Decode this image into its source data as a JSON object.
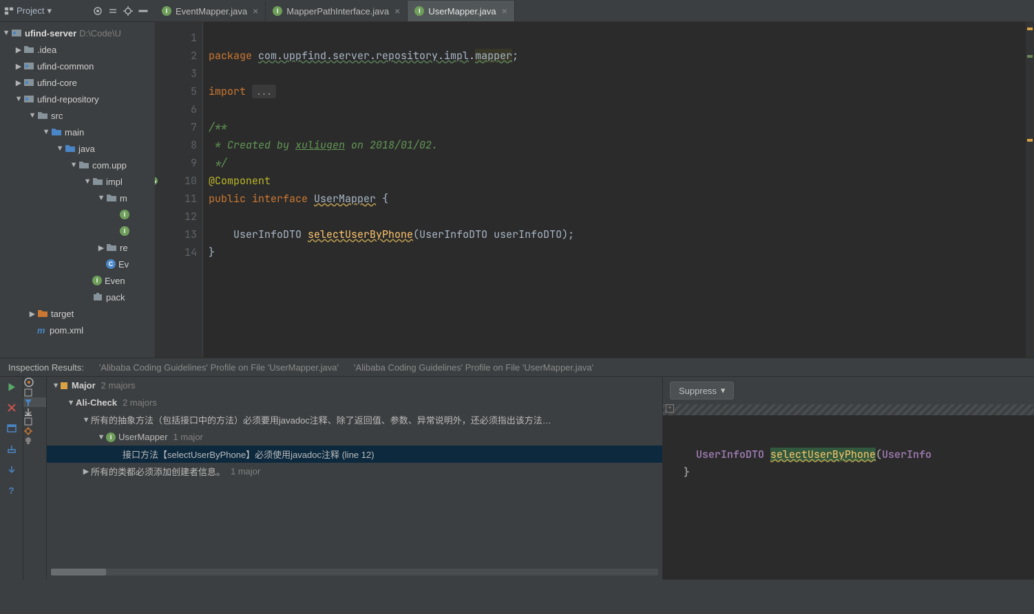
{
  "projectPanel": {
    "title": "Project",
    "root": {
      "label": "ufind-server",
      "path": "D:\\Code\\U"
    },
    "nodes": [
      {
        "indent": 22,
        "arrow": "▶",
        "icon": "folder",
        "label": ".idea"
      },
      {
        "indent": 22,
        "arrow": "▶",
        "icon": "module",
        "label": "ufind-common"
      },
      {
        "indent": 22,
        "arrow": "▶",
        "icon": "module",
        "label": "ufind-core"
      },
      {
        "indent": 22,
        "arrow": "▼",
        "icon": "module",
        "label": "ufind-repository"
      },
      {
        "indent": 42,
        "arrow": "▼",
        "icon": "folder",
        "label": "src"
      },
      {
        "indent": 62,
        "arrow": "▼",
        "icon": "folder-blue",
        "label": "main"
      },
      {
        "indent": 82,
        "arrow": "▼",
        "icon": "folder-blue",
        "label": "java"
      },
      {
        "indent": 102,
        "arrow": "▼",
        "icon": "folder",
        "label": "com.upp"
      },
      {
        "indent": 122,
        "arrow": "▼",
        "icon": "folder",
        "label": "impl"
      },
      {
        "indent": 142,
        "arrow": "▼",
        "icon": "folder",
        "label": "m"
      },
      {
        "indent": 162,
        "arrow": "",
        "icon": "java",
        "label": ""
      },
      {
        "indent": 162,
        "arrow": "",
        "icon": "java",
        "label": ""
      },
      {
        "indent": 142,
        "arrow": "▶",
        "icon": "folder",
        "label": "re"
      },
      {
        "indent": 142,
        "arrow": "",
        "icon": "class",
        "label": "Ev"
      },
      {
        "indent": 122,
        "arrow": "",
        "icon": "java",
        "label": "Even"
      },
      {
        "indent": 122,
        "arrow": "",
        "icon": "pkg",
        "label": "pack"
      },
      {
        "indent": 42,
        "arrow": "▶",
        "icon": "folder-orange",
        "label": "target"
      },
      {
        "indent": 42,
        "arrow": "",
        "icon": "m",
        "label": "pom.xml"
      }
    ]
  },
  "tabs": [
    {
      "label": "EventMapper.java",
      "active": false
    },
    {
      "label": "MapperPathInterface.java",
      "active": false
    },
    {
      "label": "UserMapper.java",
      "active": true
    }
  ],
  "gutter": [
    "1",
    "2",
    "3",
    "5",
    "6",
    "7",
    "8",
    "9",
    "10",
    "11",
    "12",
    "13",
    "14"
  ],
  "code": {
    "pkg_kw": "package",
    "pkg_path": "com.uppfind.server.repository.impl",
    "pkg_last": "mapper",
    "import_kw": "import ",
    "import_fold": "...",
    "c1": "/**",
    "c2": " * Created by ",
    "c2_link": "xuliugen",
    "c2_b": " on 2018/01/02.",
    "c3": " */",
    "annotation": "@Component",
    "public": "public ",
    "interface": "interface ",
    "clsname": "UserMapper",
    "open": " {",
    "ret": "UserInfoDTO ",
    "method": "selectUserByPhone",
    "lp": "(",
    "ptype": "UserInfoDTO",
    "pname": " userInfoDTO",
    "rp": ");",
    "close": "}"
  },
  "inspection": {
    "label": "Inspection Results:",
    "profile1": "'Alibaba Coding Guidelines' Profile on File 'UserMapper.java'",
    "profile2": "'Alibaba Coding Guidelines' Profile on File 'UserMapper.java'",
    "major": "Major",
    "major_count": "2 majors",
    "alicheck": "Ali-Check",
    "alicheck_count": "2 majors",
    "rule1": "所有的抽象方法（包括接口中的方法）必须要用javadoc注释、除了返回值、参数、异常说明外，还必须指出该方法…",
    "usermapper": "UserMapper",
    "usermapper_count": "1 major",
    "violation": "接口方法【selectUserByPhone】必须使用javadoc注释 (line 12)",
    "rule2": "所有的类都必须添加创建者信息。",
    "rule2_count": "1 major",
    "suppress": "Suppress",
    "preview": {
      "ret": "UserInfoDTO ",
      "method": "selectUserByPhone",
      "lp": "(",
      "ptype": "UserInfo",
      "close": "}"
    }
  }
}
